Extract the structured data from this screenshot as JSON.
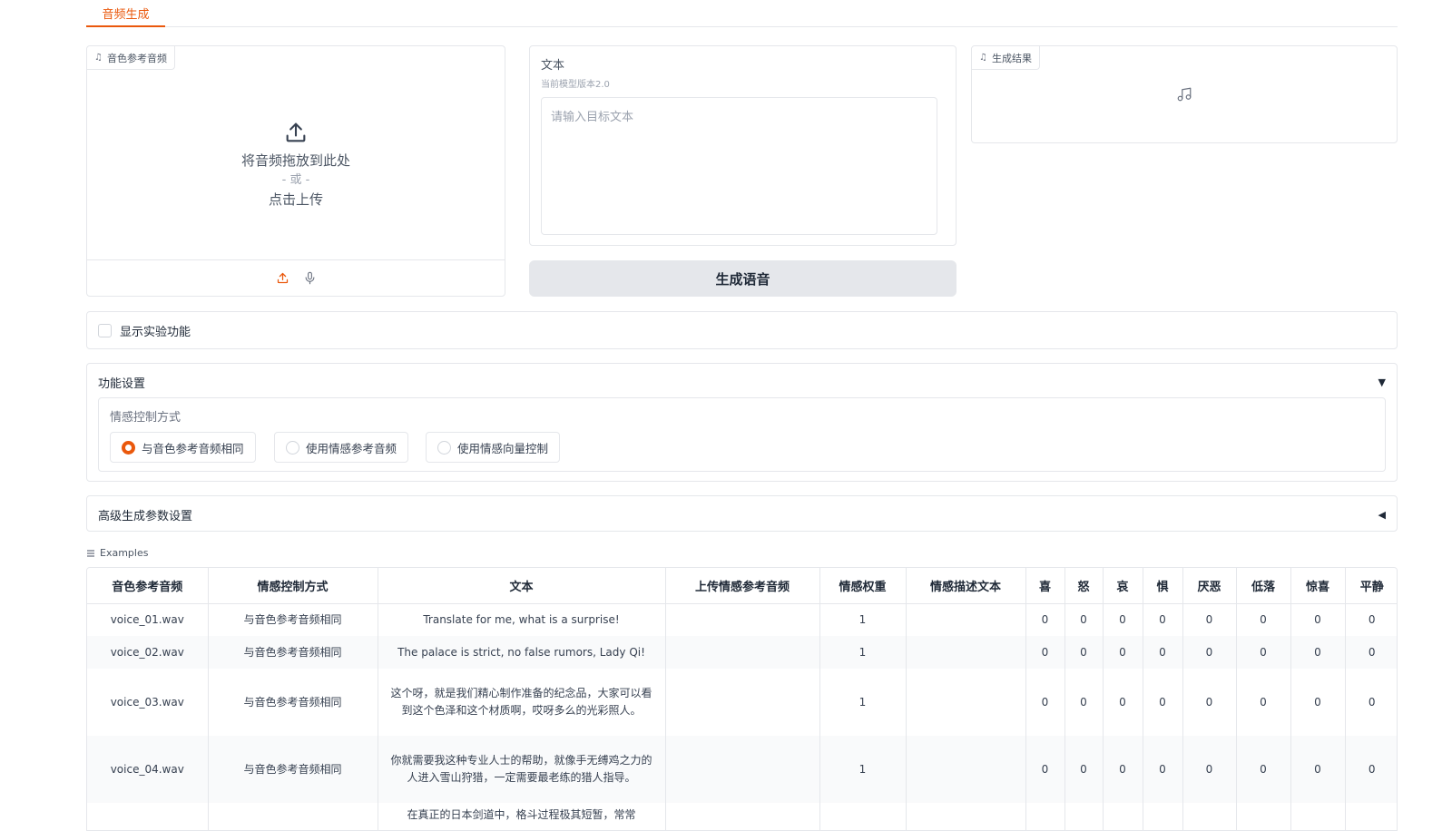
{
  "tabs": [
    {
      "label": "音频生成"
    }
  ],
  "ref_audio": {
    "label": "音色参考音频",
    "drop_text": "将音频拖放到此处",
    "or_text": "- 或 -",
    "click_text": "点击上传"
  },
  "text_panel": {
    "label": "文本",
    "sub": "当前模型版本2.0",
    "placeholder": "请输入目标文本"
  },
  "generate_button": "生成语音",
  "result": {
    "label": "生成结果"
  },
  "experimental": {
    "label": "显示实验功能"
  },
  "settings": {
    "title": "功能设置",
    "arrow": "▼",
    "emotion_label": "情感控制方式",
    "options": [
      "与音色参考音频相同",
      "使用情感参考音频",
      "使用情感向量控制"
    ],
    "selected": 0
  },
  "advanced": {
    "title": "高级生成参数设置",
    "arrow": "◀"
  },
  "examples": {
    "label": "Examples",
    "columns": [
      "音色参考音频",
      "情感控制方式",
      "文本",
      "上传情感参考音频",
      "情感权重",
      "情感描述文本",
      "喜",
      "怒",
      "哀",
      "惧",
      "厌恶",
      "低落",
      "惊喜",
      "平静"
    ],
    "rows": [
      [
        "voice_01.wav",
        "与音色参考音频相同",
        "Translate for me, what is a surprise!",
        "",
        "1",
        "",
        "0",
        "0",
        "0",
        "0",
        "0",
        "0",
        "0",
        "0"
      ],
      [
        "voice_02.wav",
        "与音色参考音频相同",
        "The palace is strict, no false rumors, Lady Qi!",
        "",
        "1",
        "",
        "0",
        "0",
        "0",
        "0",
        "0",
        "0",
        "0",
        "0"
      ],
      [
        "voice_03.wav",
        "与音色参考音频相同",
        "这个呀，就是我们精心制作准备的纪念品，大家可以看到这个色泽和这个材质啊，哎呀多么的光彩照人。",
        "",
        "1",
        "",
        "0",
        "0",
        "0",
        "0",
        "0",
        "0",
        "0",
        "0"
      ],
      [
        "voice_04.wav",
        "与音色参考音频相同",
        "你就需要我这种专业人士的帮助，就像手无缚鸡之力的人进入雪山狩猎，一定需要最老练的猎人指导。",
        "",
        "1",
        "",
        "0",
        "0",
        "0",
        "0",
        "0",
        "0",
        "0",
        "0"
      ],
      [
        "",
        "",
        "在真正的日本剑道中，格斗过程极其短暂，常常",
        "",
        "",
        "",
        "",
        "",
        "",
        "",
        "",
        "",
        "",
        ""
      ]
    ]
  }
}
